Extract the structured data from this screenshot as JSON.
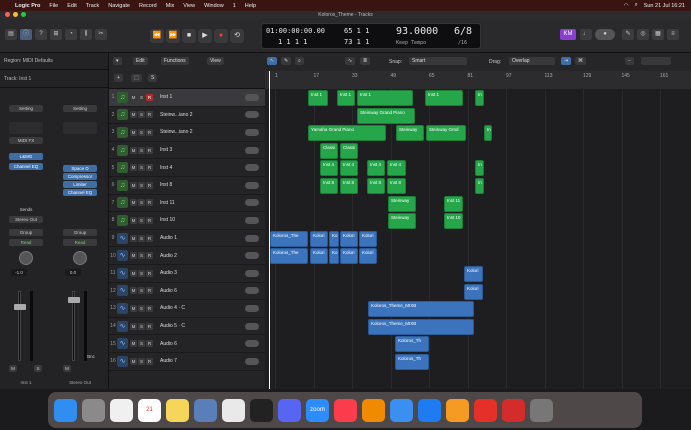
{
  "menubar": {
    "items": [
      "Logic Pro",
      "File",
      "Edit",
      "Track",
      "Navigate",
      "Record",
      "Mix",
      "View",
      "Window",
      "1",
      "Help"
    ],
    "clock": "Sun 21 Jul  16:21"
  },
  "window": {
    "title": "Koloros_Theme - Tracks"
  },
  "lcd": {
    "time_top": "01:00:00:00.00",
    "time_bottom": "1  1  1  1",
    "bars_top": "65  1  1",
    "bars_bottom": "73  1  1",
    "tempo": "93.0000",
    "tempo_label": "Keep Tempo",
    "sig": "6/8",
    "division": "/16"
  },
  "inspector": {
    "region": "Region: MIDI Defaults",
    "track": "Track: Inst 1",
    "strip1": {
      "setting": "Setting",
      "plugin": "MIDI FX",
      "eq": "EQ",
      "instrument": "L&MG",
      "channel_eq": "Channel EQ",
      "sends": "Sends",
      "output": "Stereo Out",
      "group": "Group",
      "read": "Read",
      "value": "-1.0",
      "name": "Inst 1"
    },
    "strip2": {
      "setting": "Setting",
      "plugin1": "Space D",
      "plugin2": "Compressor",
      "plugin3": "Limiter",
      "plugin4": "Channel EQ",
      "output": "",
      "group": "Group",
      "read": "Read",
      "value": "0.0",
      "bnc": "Bnc",
      "name": "Stereo Out"
    }
  },
  "header": {
    "edit": "Edit",
    "functions": "Functions",
    "view": "View",
    "snap_label": "Snap:",
    "snap": "Smart",
    "drag_label": "Drag:",
    "drag": "Overlap"
  },
  "ruler": [
    "1",
    "17",
    "33",
    "49",
    "65",
    "81",
    "97",
    "113",
    "129",
    "145",
    "161"
  ],
  "tracks": [
    {
      "num": "1",
      "type": "midi",
      "name": "Inst 1",
      "sel": true
    },
    {
      "num": "2",
      "type": "midi",
      "name": "Steinw...iano 2"
    },
    {
      "num": "3",
      "type": "midi",
      "name": "Steinw...iano 2"
    },
    {
      "num": "4",
      "type": "midi",
      "name": "Inst 3"
    },
    {
      "num": "5",
      "type": "midi",
      "name": "Inst 4"
    },
    {
      "num": "6",
      "type": "midi",
      "name": "Inst 8"
    },
    {
      "num": "7",
      "type": "midi",
      "name": "Inst 11"
    },
    {
      "num": "8",
      "type": "midi",
      "name": "Inst 10"
    },
    {
      "num": "9",
      "type": "audio",
      "name": "Audio 1"
    },
    {
      "num": "10",
      "type": "audio",
      "name": "Audio 2"
    },
    {
      "num": "11",
      "type": "audio",
      "name": "Audio 3"
    },
    {
      "num": "12",
      "type": "audio",
      "name": "Audio 6"
    },
    {
      "num": "13",
      "type": "audio",
      "name": "Audio 4 · C"
    },
    {
      "num": "14",
      "type": "audio",
      "name": "Audio 5 · C"
    },
    {
      "num": "15",
      "type": "audio",
      "name": "Audio 6"
    },
    {
      "num": "16",
      "type": "audio",
      "name": "Audio 7"
    }
  ],
  "regions": [
    {
      "row": 0,
      "start": 43,
      "width": 20,
      "type": "midi",
      "label": "Inst 1"
    },
    {
      "row": 0,
      "start": 72,
      "width": 18,
      "type": "midi",
      "label": "Inst 1"
    },
    {
      "row": 0,
      "start": 92,
      "width": 56,
      "type": "midi",
      "label": "Inst 1"
    },
    {
      "row": 0,
      "start": 160,
      "width": 38,
      "type": "midi",
      "label": "Inst 1"
    },
    {
      "row": 0,
      "start": 210,
      "width": 9,
      "type": "midi",
      "label": "In"
    },
    {
      "row": 1,
      "start": 92,
      "width": 58,
      "type": "midi",
      "label": "Steinway Grand Piano"
    },
    {
      "row": 2,
      "start": 43,
      "width": 78,
      "type": "midi",
      "label": "Yamaha Grand Piano"
    },
    {
      "row": 2,
      "start": 131,
      "width": 28,
      "type": "midi",
      "label": "Steinway"
    },
    {
      "row": 2,
      "start": 161,
      "width": 40,
      "type": "midi",
      "label": "Steinway Grnd"
    },
    {
      "row": 2,
      "start": 219,
      "width": 8,
      "type": "midi",
      "label": "In"
    },
    {
      "row": 3,
      "start": 55,
      "width": 18,
      "type": "midi",
      "label": "Classi"
    },
    {
      "row": 3,
      "start": 75,
      "width": 18,
      "type": "midi",
      "label": "Classi"
    },
    {
      "row": 4,
      "start": 55,
      "width": 18,
      "type": "midi",
      "label": "Inst 4"
    },
    {
      "row": 4,
      "start": 75,
      "width": 18,
      "type": "midi",
      "label": "Inst 4"
    },
    {
      "row": 4,
      "start": 102,
      "width": 18,
      "type": "midi",
      "label": "Inst 4"
    },
    {
      "row": 4,
      "start": 122,
      "width": 19,
      "type": "midi",
      "label": "Inst 4"
    },
    {
      "row": 4,
      "start": 210,
      "width": 9,
      "type": "midi",
      "label": "In"
    },
    {
      "row": 5,
      "start": 55,
      "width": 18,
      "type": "midi",
      "label": "Inst 8"
    },
    {
      "row": 5,
      "start": 75,
      "width": 18,
      "type": "midi",
      "label": "Inst 8"
    },
    {
      "row": 5,
      "start": 102,
      "width": 18,
      "type": "midi",
      "label": "Inst 8"
    },
    {
      "row": 5,
      "start": 122,
      "width": 19,
      "type": "midi",
      "label": "Inst 8"
    },
    {
      "row": 5,
      "start": 210,
      "width": 9,
      "type": "midi",
      "label": "In"
    },
    {
      "row": 6,
      "start": 123,
      "width": 28,
      "type": "midi",
      "label": "Steinway"
    },
    {
      "row": 6,
      "start": 179,
      "width": 19,
      "type": "midi",
      "label": "Inst 11"
    },
    {
      "row": 7,
      "start": 123,
      "width": 28,
      "type": "midi",
      "label": "Steinway"
    },
    {
      "row": 7,
      "start": 179,
      "width": 19,
      "type": "midi",
      "label": "Inst 10"
    },
    {
      "row": 8,
      "start": 5,
      "width": 38,
      "type": "audio",
      "label": "Koloros_The"
    },
    {
      "row": 8,
      "start": 45,
      "width": 18,
      "type": "audio",
      "label": "Kolori"
    },
    {
      "row": 8,
      "start": 64,
      "width": 10,
      "type": "audio",
      "label": "Ko"
    },
    {
      "row": 8,
      "start": 75,
      "width": 18,
      "type": "audio",
      "label": "Kolori"
    },
    {
      "row": 8,
      "start": 94,
      "width": 18,
      "type": "audio",
      "label": "Kolori"
    },
    {
      "row": 9,
      "start": 5,
      "width": 38,
      "type": "audio",
      "label": "Koloros_The"
    },
    {
      "row": 9,
      "start": 45,
      "width": 18,
      "type": "audio",
      "label": "Kolori"
    },
    {
      "row": 9,
      "start": 64,
      "width": 10,
      "type": "audio",
      "label": "Ko"
    },
    {
      "row": 9,
      "start": 75,
      "width": 18,
      "type": "audio",
      "label": "Kolori"
    },
    {
      "row": 9,
      "start": 94,
      "width": 18,
      "type": "audio",
      "label": "Kolori"
    },
    {
      "row": 10,
      "start": 199,
      "width": 19,
      "type": "audio",
      "label": "Kolori"
    },
    {
      "row": 11,
      "start": 199,
      "width": 19,
      "type": "audio",
      "label": "Kolori"
    },
    {
      "row": 12,
      "start": 103,
      "width": 106,
      "type": "audio",
      "label": "Koloros_Theme_MIXB"
    },
    {
      "row": 13,
      "start": 103,
      "width": 106,
      "type": "audio",
      "label": "Koloros_Theme_MIXB"
    },
    {
      "row": 14,
      "start": 130,
      "width": 34,
      "type": "audio",
      "label": "Koloros_Th"
    },
    {
      "row": 15,
      "start": 130,
      "width": 34,
      "type": "audio",
      "label": "Koloros_Th"
    }
  ],
  "colors": {
    "midi": "#26a64a",
    "audio": "#3b74bd",
    "accent": "#3f6ea6"
  },
  "dock": [
    {
      "name": "finder-icon",
      "color": "#2f8ef0"
    },
    {
      "name": "settings-icon",
      "color": "#8a8a8a"
    },
    {
      "name": "photos-icon",
      "color": "#f0f0f0"
    },
    {
      "name": "calendar-icon",
      "color": "#ffffff",
      "label": "21"
    },
    {
      "name": "notes-icon",
      "color": "#f6d65a"
    },
    {
      "name": "preview-icon",
      "color": "#5a7fb8"
    },
    {
      "name": "chrome-icon",
      "color": "#e9e9e9"
    },
    {
      "name": "logic-icon",
      "color": "#222222"
    },
    {
      "name": "discord-icon",
      "color": "#5865f2"
    },
    {
      "name": "zoom-icon",
      "color": "#2d8cff",
      "label": "zoom"
    },
    {
      "name": "music-icon",
      "color": "#fa3c4c"
    },
    {
      "name": "vlc-icon",
      "color": "#f08a00"
    },
    {
      "name": "quicktime-icon",
      "color": "#3a8ff0"
    },
    {
      "name": "appstore-icon",
      "color": "#1f7cf0"
    },
    {
      "name": "pages-icon",
      "color": "#f59a23"
    },
    {
      "name": "creative-cloud-icon",
      "color": "#e5302a"
    },
    {
      "name": "acrobat-icon",
      "color": "#d42b2b"
    },
    {
      "name": "trash-icon",
      "color": "#777777"
    }
  ]
}
